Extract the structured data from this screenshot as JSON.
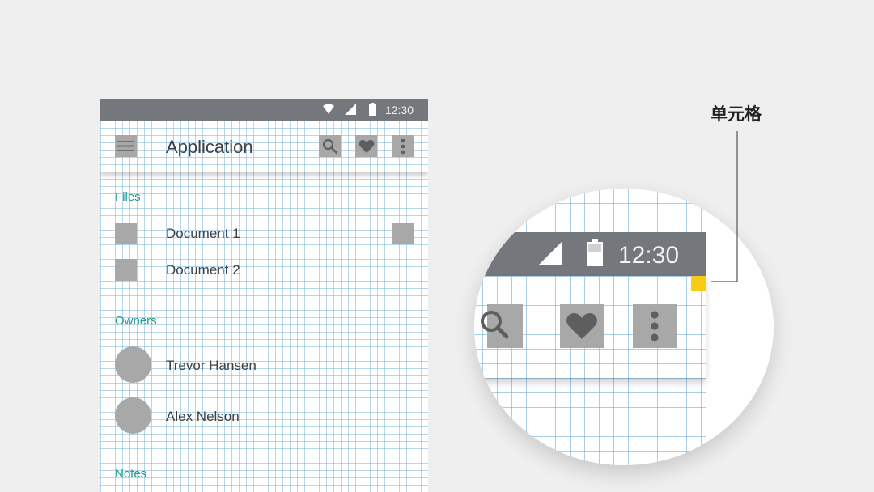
{
  "statusbar": {
    "time": "12:30"
  },
  "appbar": {
    "title": "Application"
  },
  "sections": {
    "files": {
      "label": "Files",
      "items": [
        {
          "label": "Document 1"
        },
        {
          "label": "Document 2"
        }
      ]
    },
    "owners": {
      "label": "Owners",
      "items": [
        {
          "name": "Trevor Hansen"
        },
        {
          "name": "Alex Nelson"
        }
      ]
    },
    "notes": {
      "label": "Notes"
    }
  },
  "zoom": {
    "time": "12:30"
  },
  "callout": {
    "label": "单元格"
  },
  "colors": {
    "status_bar": "#74777c",
    "placeholder": "#a8a8a8",
    "accent_teal": "#1a9a92",
    "highlight_cell": "#f7cc15",
    "grid_line": "#7db4d7"
  },
  "icons": [
    "menu-icon",
    "search-icon",
    "heart-icon",
    "more-vert-icon",
    "wifi-icon",
    "signal-icon",
    "battery-icon"
  ]
}
